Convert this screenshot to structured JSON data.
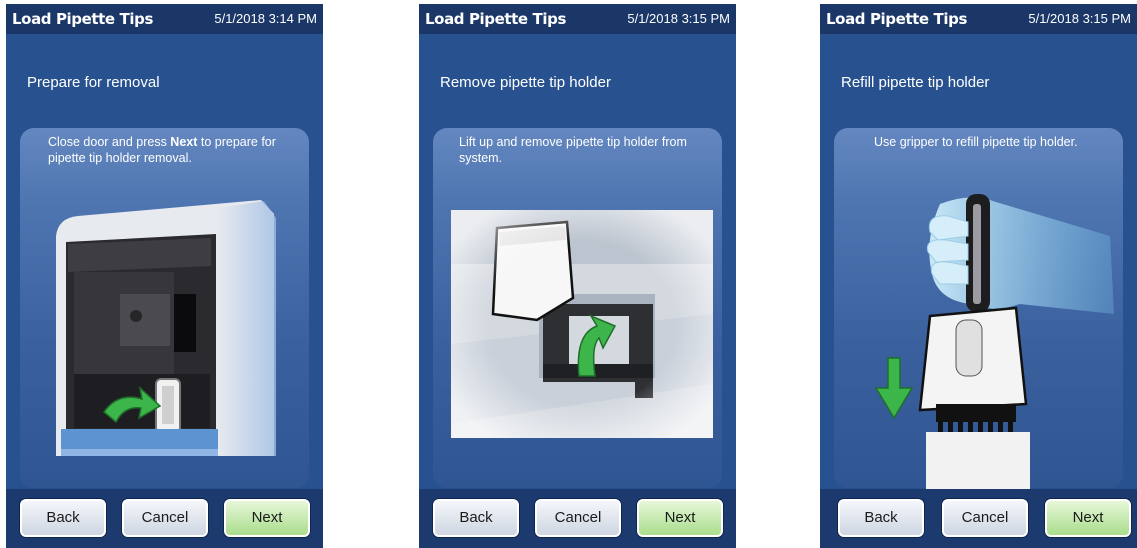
{
  "colors": {
    "header_bg": "#1a3768",
    "screen_bg": "#28528f",
    "bottom_bar_bg": "#1c3a6d",
    "next_button": "#b8e39e",
    "arrow_green": "#3cb64a"
  },
  "screens": [
    {
      "header": {
        "title": "Load Pipette Tips",
        "datetime": "5/1/2018 3:14 PM"
      },
      "step_title": "Prepare for removal",
      "instruction": {
        "before": "Close door and press ",
        "bold": "Next",
        "after": " to prepare for pipette tip holder removal."
      },
      "illustration": "instrument-door-illustration",
      "buttons": {
        "back": "Back",
        "cancel": "Cancel",
        "next": "Next"
      }
    },
    {
      "header": {
        "title": "Load Pipette Tips",
        "datetime": "5/1/2018 3:15 PM"
      },
      "step_title": "Remove pipette tip holder",
      "instruction": {
        "before": "Lift up and remove pipette tip holder from system.",
        "bold": "",
        "after": ""
      },
      "illustration": "tip-holder-removal-illustration",
      "buttons": {
        "back": "Back",
        "cancel": "Cancel",
        "next": "Next"
      }
    },
    {
      "header": {
        "title": "Load Pipette Tips",
        "datetime": "5/1/2018 3:15 PM"
      },
      "step_title": "Refill pipette tip holder",
      "instruction": {
        "before": "Use gripper to refill pipette tip holder.",
        "bold": "",
        "after": ""
      },
      "illustration": "gripper-refill-illustration",
      "buttons": {
        "back": "Back",
        "cancel": "Cancel",
        "next": "Next"
      }
    }
  ]
}
